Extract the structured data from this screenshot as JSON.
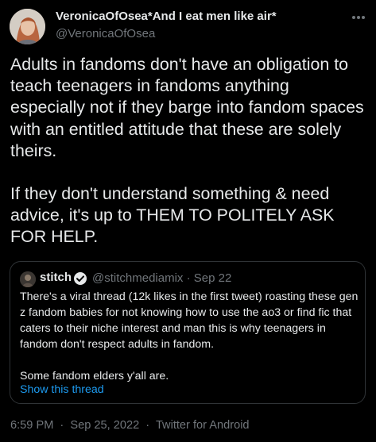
{
  "tweet": {
    "author": {
      "display_name": "VeronicaOfOsea*And I eat men like air*",
      "handle": "@VeronicaOfOsea"
    },
    "more_icon": "more-horizontal-icon",
    "body_paragraphs": [
      "Adults in fandoms don't have an obligation to teach teenagers in fandoms anything especially not if they barge into fandom spaces with an entitled attitude that these are solely theirs.",
      "If they don't understand something & need advice, it's up to THEM TO POLITELY ASK FOR HELP."
    ],
    "quoted": {
      "display_name": "stitch",
      "verified_icon": "verified-badge-icon",
      "handle": "@stitchmediamix",
      "dot": "·",
      "date": "Sep 22",
      "text_paragraphs": [
        "There's a viral thread (12k likes in the first tweet) roasting these gen z fandom babies for not knowing how to use the ao3 or find fic that caters to their niche interest and man this is why teenagers in fandom don't respect adults in fandom.",
        "Some fandom elders y'all are."
      ],
      "show_thread_label": "Show this thread"
    },
    "footer": {
      "time": "6:59 PM",
      "date": "Sep 25, 2022",
      "source": "Twitter for Android",
      "separator": "·"
    }
  },
  "colors": {
    "background": "#000000",
    "text_primary": "#e7e9ea",
    "text_secondary": "#71767b",
    "link": "#1d9bf0",
    "border": "#2f3336"
  }
}
